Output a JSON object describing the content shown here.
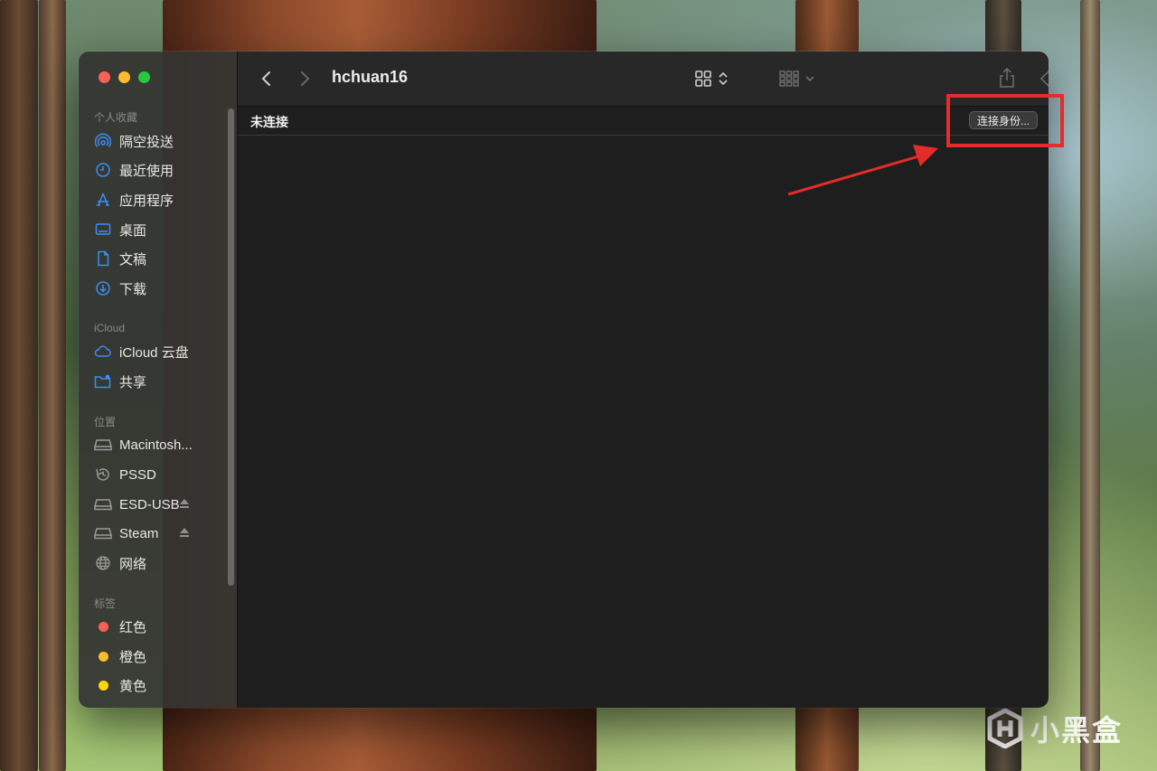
{
  "window": {
    "title": "hchuan16",
    "status_text": "未连接",
    "connect_button": "连接身份..."
  },
  "sidebar": {
    "sections": [
      {
        "header": "个人收藏",
        "items": [
          {
            "label": "隔空投送",
            "icon": "airdrop-icon"
          },
          {
            "label": "最近使用",
            "icon": "clock-icon"
          },
          {
            "label": "应用程序",
            "icon": "applications-icon"
          },
          {
            "label": "桌面",
            "icon": "desktop-icon"
          },
          {
            "label": "文稿",
            "icon": "document-icon"
          },
          {
            "label": "下载",
            "icon": "download-icon"
          }
        ]
      },
      {
        "header": "iCloud",
        "items": [
          {
            "label": "iCloud 云盘",
            "icon": "cloud-icon"
          },
          {
            "label": "共享",
            "icon": "shared-folder-icon"
          }
        ]
      },
      {
        "header": "位置",
        "items": [
          {
            "label": "Macintosh...",
            "icon": "drive-icon"
          },
          {
            "label": "PSSD",
            "icon": "time-machine-icon"
          },
          {
            "label": "ESD-USB",
            "icon": "drive-icon",
            "eject": true
          },
          {
            "label": "Steam",
            "icon": "drive-icon",
            "eject": true
          },
          {
            "label": "网络",
            "icon": "network-globe-icon"
          }
        ]
      },
      {
        "header": "标签",
        "items": [
          {
            "label": "红色",
            "color": "#fe5f57"
          },
          {
            "label": "橙色",
            "color": "#febc2e"
          },
          {
            "label": "黄色",
            "color": "#fdd60a"
          }
        ]
      }
    ]
  },
  "watermark": {
    "text": "小黑盒"
  },
  "colors": {
    "accent": "#3a8ef6",
    "annotation": "#e62b2b"
  }
}
